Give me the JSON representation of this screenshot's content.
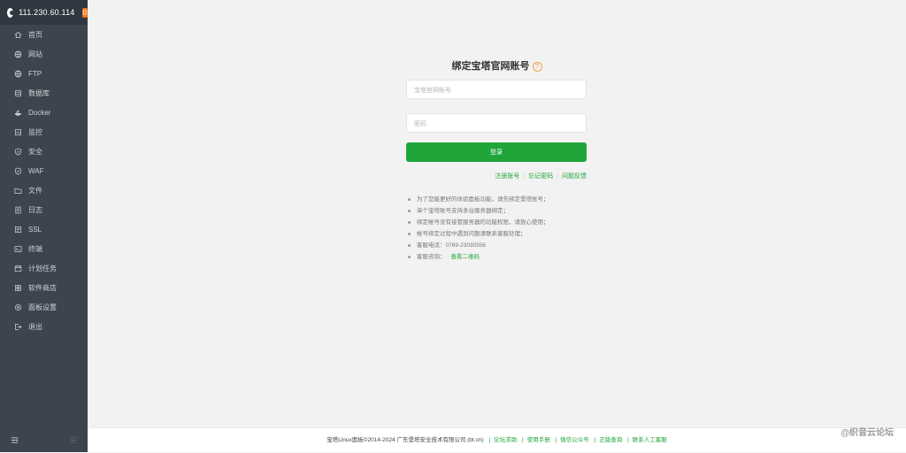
{
  "sidebar": {
    "ip": "111.230.60.114",
    "badge": "0",
    "items": [
      {
        "label": "首页",
        "icon": "home-icon"
      },
      {
        "label": "网站",
        "icon": "globe-icon"
      },
      {
        "label": "FTP",
        "icon": "globe-icon"
      },
      {
        "label": "数据库",
        "icon": "database-icon"
      },
      {
        "label": "Docker",
        "icon": "docker-icon"
      },
      {
        "label": "监控",
        "icon": "monitor-icon"
      },
      {
        "label": "安全",
        "icon": "shield-icon"
      },
      {
        "label": "WAF",
        "icon": "shield-icon"
      },
      {
        "label": "文件",
        "icon": "folder-icon"
      },
      {
        "label": "日志",
        "icon": "log-icon"
      },
      {
        "label": "SSL",
        "icon": "certificate-icon"
      },
      {
        "label": "终端",
        "icon": "terminal-icon"
      },
      {
        "label": "计划任务",
        "icon": "calendar-icon"
      },
      {
        "label": "软件商店",
        "icon": "grid-icon"
      },
      {
        "label": "面板设置",
        "icon": "settings-icon"
      },
      {
        "label": "退出",
        "icon": "logout-icon"
      }
    ]
  },
  "login": {
    "title": "绑定宝塔官网账号",
    "account_placeholder": "宝塔官网账号",
    "password_placeholder": "密码",
    "submit_label": "登录",
    "links": [
      "注册账号",
      "忘记密码",
      "问题反馈"
    ]
  },
  "tips": [
    {
      "text": "为了您能更好的体验面板功能，请先绑定堡塔账号；"
    },
    {
      "text": "单个宝塔账号支持多台服务器绑定；"
    },
    {
      "text": "绑定帐号没有接管服务器的功能权限，请放心使用；"
    },
    {
      "text": "帐号绑定过程中遇到问题请联系客服处理；"
    },
    {
      "text": "客服电话：0769-23030556"
    },
    {
      "text": "客服咨询：",
      "link": "查看二维码"
    }
  ],
  "footer": {
    "copyright": "宝塔Linux面板©2014-2024 广东堡塔安全技术有限公司 (bt.cn)",
    "links": [
      "论坛求助",
      "使用手册",
      "微信公众号",
      "正版查询",
      "联系人工客服"
    ]
  },
  "watermark": "@织音云论坛",
  "colors": {
    "sidebar_bg": "#3c444d",
    "sidebar_header_bg": "#2f3740",
    "accent": "#20a53a",
    "badge": "#f0761e",
    "page_bg": "#f2f2f2"
  }
}
